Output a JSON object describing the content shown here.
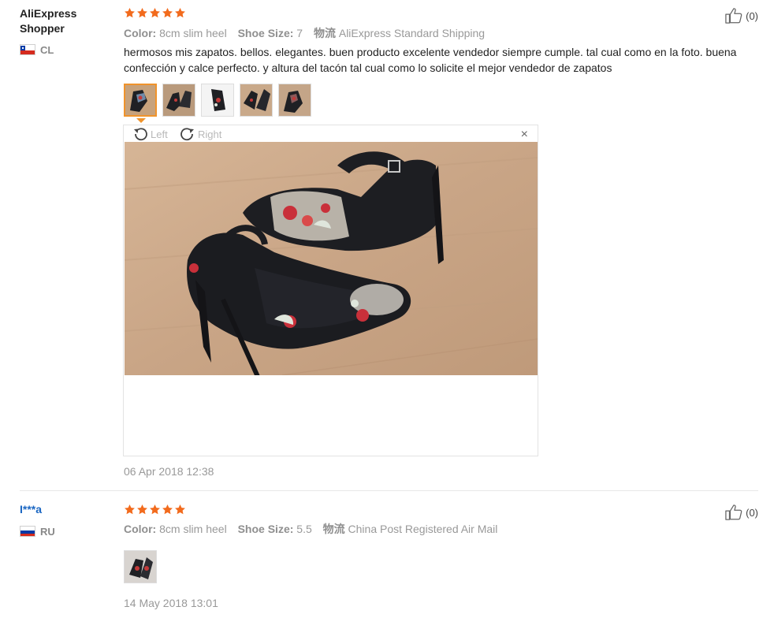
{
  "reviews": [
    {
      "user": "AliExpress Shopper",
      "country_code": "CL",
      "rating": 5,
      "attributes": {
        "color_label": "Color:",
        "color_value": "8cm slim heel",
        "size_label": "Shoe Size:",
        "size_value": "7",
        "shipping_label": "物流",
        "shipping_value": "AliExpress Standard Shipping"
      },
      "helpful": "(0)",
      "text": "hermosos mis zapatos. bellos. elegantes. buen producto excelente vendedor siempre cumple. tal cual como en la foto. buena confección y calce perfecto. y altura del tacón tal cual como lo solicite el mejor vendedor de zapatos",
      "thumbnail_count": 5,
      "viewer": {
        "rotate_left": "Left",
        "rotate_right": "Right",
        "close": "×"
      },
      "date": "06 Apr 2018 12:38"
    },
    {
      "user": "I***a",
      "country_code": "RU",
      "rating": 5,
      "attributes": {
        "color_label": "Color:",
        "color_value": "8cm slim heel",
        "size_label": "Shoe Size:",
        "size_value": "5.5",
        "shipping_label": "物流",
        "shipping_value": "China Post Registered Air Mail"
      },
      "helpful": "(0)",
      "thumbnail_count": 1,
      "date": "14 May 2018 13:01"
    }
  ],
  "icons": {
    "star": "star-icon",
    "thumb_up": "thumb-up-icon",
    "rotate_left": "rotate-left-icon",
    "rotate_right": "rotate-right-icon",
    "close": "close-icon"
  },
  "colors": {
    "star": "#f26b1d",
    "accent": "#f0932b",
    "link": "#1a66c2",
    "muted": "#999999"
  }
}
